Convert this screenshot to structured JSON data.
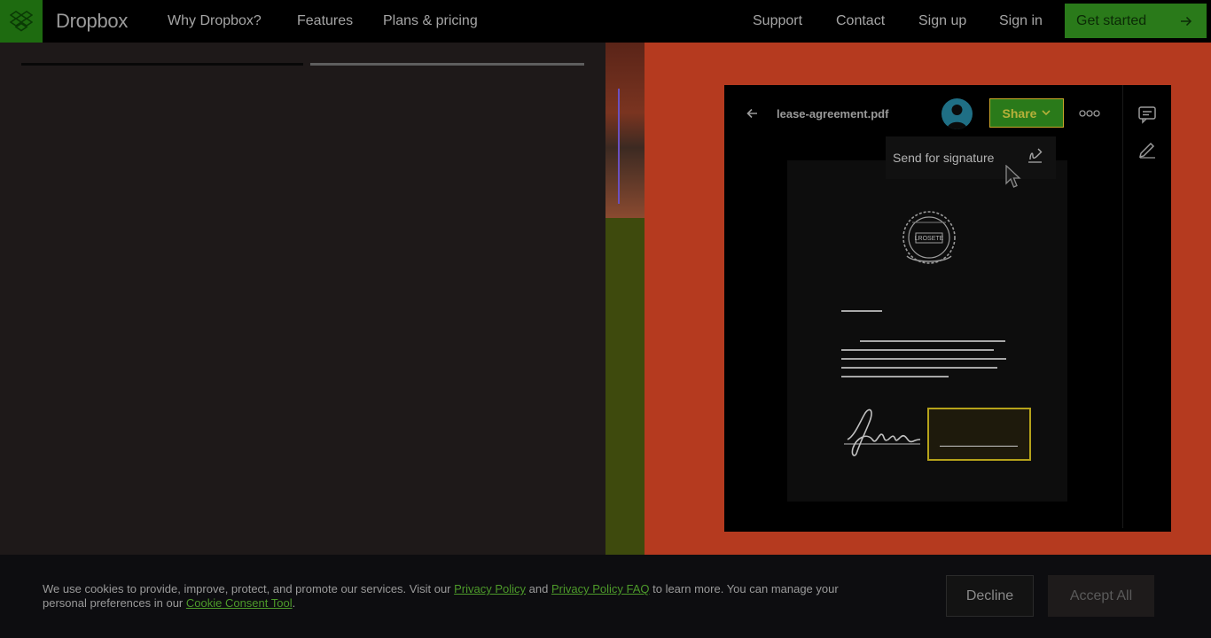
{
  "header": {
    "brand": "Dropbox",
    "nav": [
      "Why Dropbox?",
      "Features",
      "Plans & pricing"
    ],
    "right_nav": [
      "Support",
      "Contact",
      "Sign up",
      "Sign in"
    ],
    "cta_label": "Get started"
  },
  "mock_app": {
    "filename": "lease-agreement.pdf",
    "share_label": "Share",
    "dropdown_item": "Send for signature",
    "seal_text": "LROSETE"
  },
  "cookie": {
    "text_1": "We use cookies to provide, improve, protect, and promote our services. Visit our ",
    "link_1": "Privacy Policy",
    "text_2": " and ",
    "link_2": "Privacy Policy FAQ",
    "text_3": " to learn more. You can manage your personal preferences in our ",
    "link_3": "Cookie Consent Tool",
    "text_4": ".",
    "decline_label": "Decline",
    "accept_label": "Accept All"
  },
  "colors": {
    "brand_green": "#1e6b10",
    "panel_orange": "#b53a1f",
    "strip_olive": "#3e4a0d",
    "signature_yellow": "#b5a21a"
  }
}
